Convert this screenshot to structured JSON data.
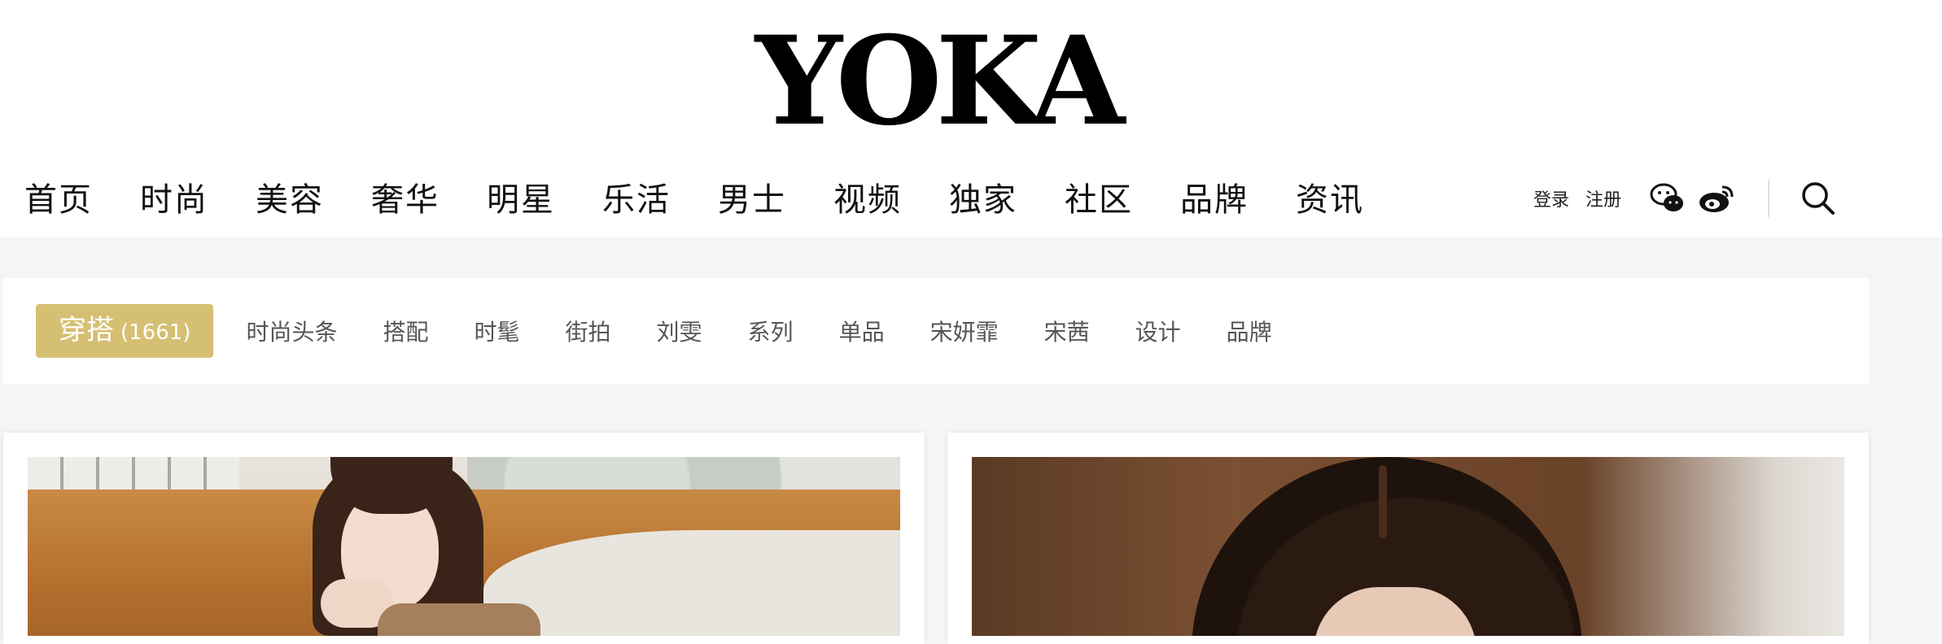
{
  "logo": {
    "text": "YOKA"
  },
  "main_nav": {
    "items": [
      "首页",
      "时尚",
      "美容",
      "奢华",
      "明星",
      "乐活",
      "男士",
      "视频",
      "独家",
      "社区",
      "品牌",
      "资讯"
    ]
  },
  "user_bar": {
    "login": "登录",
    "register": "注册",
    "icons": [
      "wechat-icon",
      "weibo-icon",
      "search-icon"
    ]
  },
  "tag_bar": {
    "active": {
      "label": "穿搭",
      "count": "(1661)"
    },
    "tags": [
      "时尚头条",
      "搭配",
      "时髦",
      "街拍",
      "刘雯",
      "系列",
      "单品",
      "宋妍霏",
      "宋茜",
      "设计",
      "品牌"
    ]
  },
  "colors": {
    "accent": "#d5bf72",
    "page_bg": "#f5f5f5",
    "panel_bg": "#ffffff",
    "text_main": "#111111",
    "text_tag": "#555555"
  }
}
